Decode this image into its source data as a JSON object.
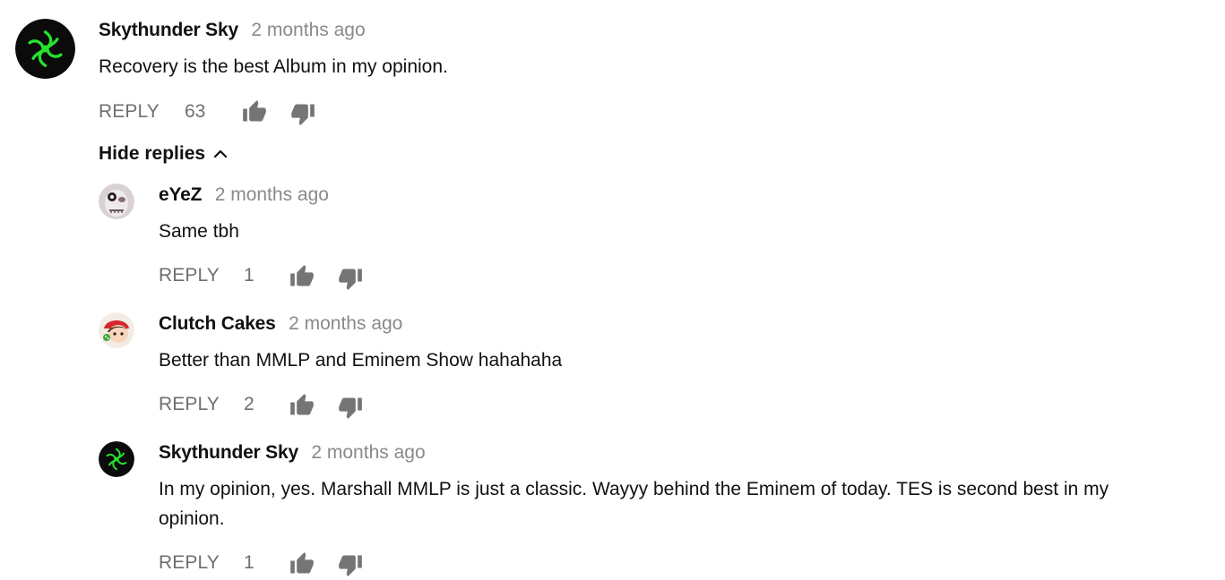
{
  "top_comment": {
    "author": "Skythunder Sky",
    "time": "2 months ago",
    "text": "Recovery is the best Album in my opinion.",
    "reply_label": "REPLY",
    "likes": "63"
  },
  "hide_replies_label": "Hide replies",
  "replies": [
    {
      "author": "eYeZ",
      "time": "2 months ago",
      "text": "Same tbh",
      "reply_label": "REPLY",
      "likes": "1"
    },
    {
      "author": "Clutch Cakes",
      "time": "2 months ago",
      "text": "Better than MMLP and Eminem Show hahahaha",
      "reply_label": "REPLY",
      "likes": "2"
    },
    {
      "author": "Skythunder Sky",
      "time": "2 months ago",
      "text_line1": "In my opinion, yes. Marshall MMLP is just a classic. Wayyy behind the Eminem of today. TES is second best in my",
      "text_line2": "opinion.",
      "reply_label": "REPLY",
      "likes": "1"
    }
  ],
  "colors": {
    "author": "#111111",
    "timestamp": "#8a8a8a",
    "action": "#6f6f6f",
    "razer_green": "#22e02a"
  }
}
